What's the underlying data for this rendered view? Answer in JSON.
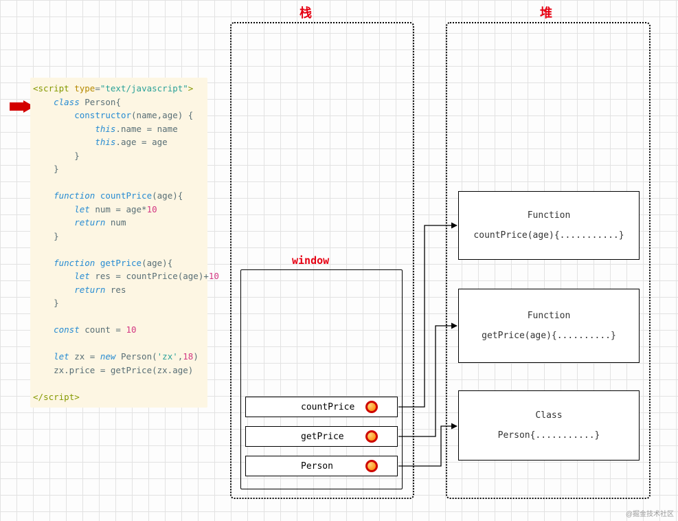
{
  "headings": {
    "stack": "栈",
    "heap": "堆",
    "window": "window"
  },
  "code": {
    "open_tag1": "<",
    "open_tag2": "script",
    "attr_name": "type",
    "attr_eq": "=",
    "attr_val": "\"text/javascript\"",
    "open_tag3": ">",
    "kw_class": "class",
    "cls_name": " Person",
    "brace_open": "{",
    "ctor": "constructor",
    "ctor_args": "(name,age) {",
    "this1a": "this",
    "this1b": ".name = name",
    "this2a": "this",
    "this2b": ".age = age",
    "brace_close": "}",
    "kw_fn": "function",
    "fn1_name": " countPrice",
    "fn1_args": "(age){",
    "let1a": "let",
    "let1b": " num = age*",
    "let1c": "10",
    "ret1a": "return",
    "ret1b": " num",
    "fn2_name": " getPrice",
    "fn2_args": "(age){",
    "let2a": "let",
    "let2b": " res = countPrice(age)+",
    "let2c": "10",
    "ret2a": "return",
    "ret2b": " res",
    "const_kw": "const",
    "const_rest": " count = ",
    "const_val": "10",
    "let3_kw": "let",
    "let3_rest": " zx = ",
    "new_kw": "new",
    "new_rest": " Person(",
    "new_str": "'zx'",
    "new_rest2": ",",
    "new_num": "18",
    "new_rest3": ")",
    "line_last": "zx.price = getPrice(zx.age)",
    "close1": "</",
    "close2": "script",
    "close3": ">"
  },
  "stack_rows": {
    "r1": "countPrice",
    "r2": "getPrice",
    "r3": "Person"
  },
  "heap_boxes": {
    "b1_t": "Function",
    "b1_b": "countPrice(age){...........}",
    "b2_t": "Function",
    "b2_b": "getPrice(age){..........}",
    "b3_t": "Class",
    "b3_b": "Person{...........}"
  },
  "watermark": "@掘金技术社区"
}
